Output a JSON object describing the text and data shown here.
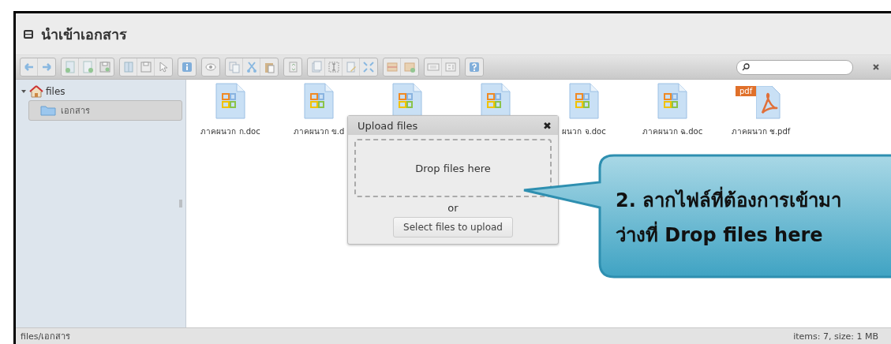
{
  "window": {
    "title": "นำเข้าเอกสาร"
  },
  "tree": [
    {
      "label": "files",
      "expanded": true,
      "selected": false,
      "children": [
        {
          "label": "เอกสาร",
          "selected": true
        }
      ]
    }
  ],
  "files": [
    {
      "kind": "doc",
      "label": "ภาคผนวก ก.doc"
    },
    {
      "kind": "doc",
      "label": "ภาคผนวก ข.d"
    },
    {
      "kind": "doc"
    },
    {
      "kind": "doc"
    },
    {
      "kind": "doc",
      "label": "ผนวก จ.doc"
    },
    {
      "kind": "doc",
      "label": "ภาคผนวก ฉ.doc"
    },
    {
      "kind": "pdf",
      "label": "ภาคผนวก ช.pdf",
      "badge": "pdf"
    }
  ],
  "upload_dialog": {
    "title": "Upload files",
    "close": "✖",
    "drop_zone": "Drop files here",
    "or": "or",
    "button": "Select files to upload"
  },
  "callout": {
    "lines": [
      "2. ลากไฟล์ที่ต้องการเข้ามา",
      "ว่างที่ Drop files here"
    ]
  },
  "status_bar": {
    "path": "files/เอกสาร",
    "summary": "items: 7, size: 1 MB"
  }
}
